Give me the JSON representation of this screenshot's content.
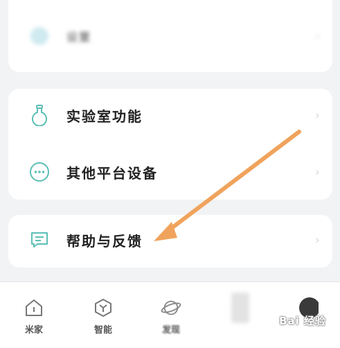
{
  "menu": {
    "top_item": {
      "label": "设置",
      "icon": "settings-circle-icon"
    },
    "items": [
      {
        "label": "实验室功能",
        "icon": "lab-flask-icon"
      },
      {
        "label": "其他平台设备",
        "icon": "more-dots-icon"
      }
    ],
    "help_item": {
      "label": "帮助与反馈",
      "icon": "message-icon"
    }
  },
  "tabbar": {
    "tabs": [
      {
        "label": "米家",
        "icon": "home-icon"
      },
      {
        "label": "智能",
        "icon": "hexagon-y-icon"
      },
      {
        "label": "发现",
        "icon": "planet-icon"
      },
      {
        "label": "",
        "icon": "blurred-tab-icon"
      },
      {
        "label": "",
        "icon": "avatar-icon"
      }
    ]
  },
  "watermark": {
    "text": "Bai 经验"
  },
  "colors": {
    "accent_teal": "#5cbfb5",
    "arrow_orange": "#f0a35c",
    "background": "#f2f3f5"
  }
}
